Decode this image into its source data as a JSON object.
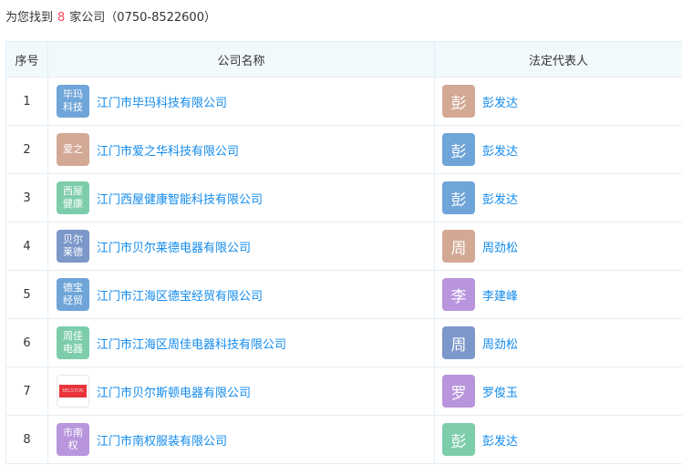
{
  "summary": {
    "prefix": "为您找到",
    "count": "8",
    "suffix": "家公司（0750-8522600）"
  },
  "table": {
    "headers": [
      "序号",
      "公司名称",
      "法定代表人"
    ],
    "rows": [
      {
        "index": "1",
        "logo_text": "毕玛\n科技",
        "logo_color": "#6fa5d8",
        "company": "江门市毕玛科技有限公司",
        "avatar": "彭",
        "avatar_color": "#d3a995",
        "person": "彭发达"
      },
      {
        "index": "2",
        "logo_text": "爱之",
        "logo_color": "#d3a995",
        "company": "江门市爱之华科技有限公司",
        "avatar": "彭",
        "avatar_color": "#6fa5d8",
        "person": "彭发达"
      },
      {
        "index": "3",
        "logo_text": "西屋\n健康",
        "logo_color": "#7dcdab",
        "company": "江门西屋健康智能科技有限公司",
        "avatar": "彭",
        "avatar_color": "#6fa5d8",
        "person": "彭发达"
      },
      {
        "index": "4",
        "logo_text": "贝尔\n莱德",
        "logo_color": "#7c97c9",
        "company": "江门市贝尔莱德电器有限公司",
        "avatar": "周",
        "avatar_color": "#d3a995",
        "person": "周劲松"
      },
      {
        "index": "5",
        "logo_text": "德宝\n经贸",
        "logo_color": "#6fa5d8",
        "company": "江门市江海区德宝经贸有限公司",
        "avatar": "李",
        "avatar_color": "#b895dc",
        "person": "李建峰"
      },
      {
        "index": "6",
        "logo_text": "周佳\n电器",
        "logo_color": "#7dcdab",
        "company": "江门市江海区周佳电器科技有限公司",
        "avatar": "周",
        "avatar_color": "#7c97c9",
        "person": "周劲松"
      },
      {
        "index": "7",
        "logo_text": "",
        "logo_color": "#ffffff",
        "company": "江门市贝尔斯顿电器有限公司",
        "avatar": "罗",
        "avatar_color": "#b895dc",
        "person": "罗俊玉"
      },
      {
        "index": "8",
        "logo_text": "市南\n权",
        "logo_color": "#b895dc",
        "company": "江门市南权服装有限公司",
        "avatar": "彭",
        "avatar_color": "#7dcdab",
        "person": "彭发达"
      }
    ]
  }
}
